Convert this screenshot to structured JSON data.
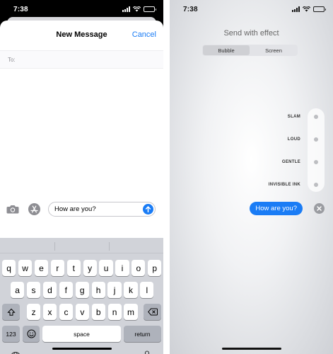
{
  "left": {
    "status_time": "7:38",
    "title": "New Message",
    "cancel_label": "Cancel",
    "to_label": "To:",
    "message_text": "How are you?",
    "keyboard": {
      "row1": [
        "q",
        "w",
        "e",
        "r",
        "t",
        "y",
        "u",
        "i",
        "o",
        "p"
      ],
      "row2": [
        "a",
        "s",
        "d",
        "f",
        "g",
        "h",
        "j",
        "k",
        "l"
      ],
      "row3": [
        "z",
        "x",
        "c",
        "v",
        "b",
        "n",
        "m"
      ],
      "numbers_label": "123",
      "space_label": "space",
      "return_label": "return"
    },
    "icons": [
      "camera-icon",
      "app-store-icon",
      "send-arrow-icon",
      "shift-icon",
      "backspace-icon",
      "emoji-icon",
      "globe-icon",
      "microphone-icon"
    ],
    "accent_color": "#1a7cf5"
  },
  "right": {
    "status_time": "7:38",
    "title": "Send with effect",
    "segments": [
      "Bubble",
      "Screen"
    ],
    "selected_segment": "Bubble",
    "effects": [
      "SLAM",
      "LOUD",
      "GENTLE",
      "INVISIBLE INK"
    ],
    "bubble_text": "How are you?",
    "icons": [
      "close-icon"
    ]
  }
}
